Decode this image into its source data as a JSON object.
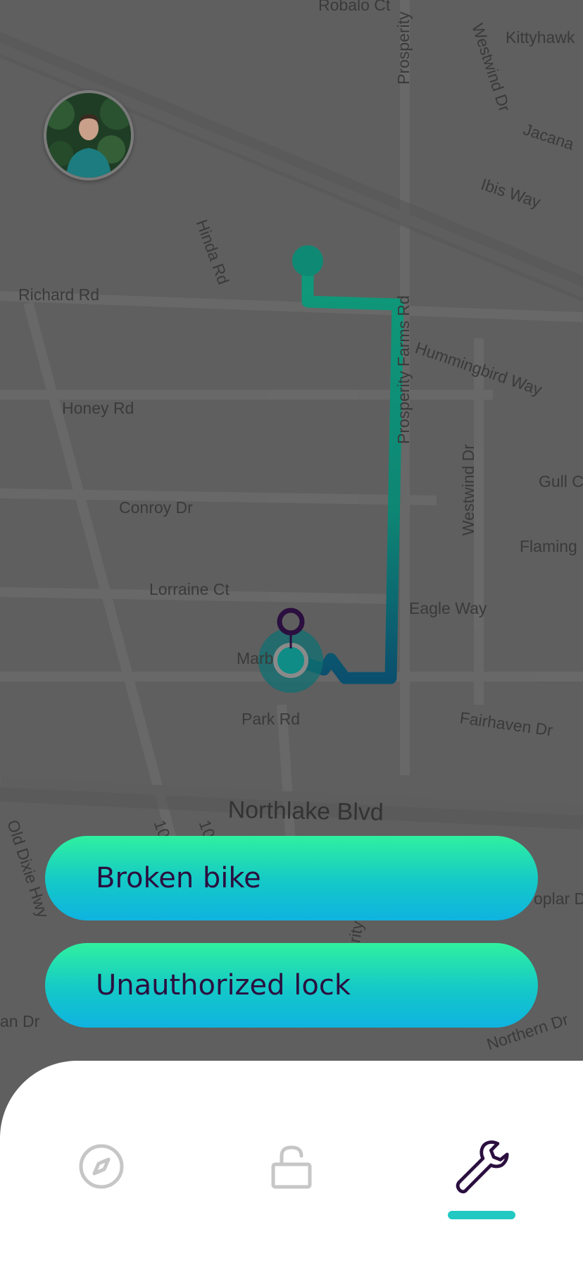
{
  "map": {
    "streets": [
      {
        "id": "robalo",
        "label": "Robalo Ct"
      },
      {
        "id": "kittyhawk",
        "label": "Kittyhawk"
      },
      {
        "id": "prosperity-top",
        "label": "Prosperity"
      },
      {
        "id": "westwind-top",
        "label": "Westwind Dr"
      },
      {
        "id": "jacana",
        "label": "Jacana"
      },
      {
        "id": "ibis",
        "label": "Ibis Way"
      },
      {
        "id": "hinda",
        "label": "Hinda Rd"
      },
      {
        "id": "richard",
        "label": "Richard Rd"
      },
      {
        "id": "prosperity-farms",
        "label": "Prosperity Farms Rd"
      },
      {
        "id": "hummingbird",
        "label": "Hummingbird Way"
      },
      {
        "id": "honey",
        "label": "Honey Rd"
      },
      {
        "id": "westwind-mid",
        "label": "Westwind Dr"
      },
      {
        "id": "gull",
        "label": "Gull C"
      },
      {
        "id": "conroy",
        "label": "Conroy Dr"
      },
      {
        "id": "flamingo",
        "label": "Flaming"
      },
      {
        "id": "lorraine",
        "label": "Lorraine Ct"
      },
      {
        "id": "eagle",
        "label": "Eagle Way"
      },
      {
        "id": "marb",
        "label": "Marb"
      },
      {
        "id": "fairhaven",
        "label": "Fairhaven Dr"
      },
      {
        "id": "park",
        "label": "Park Rd"
      },
      {
        "id": "northlake",
        "label": "Northlake Blvd"
      },
      {
        "id": "old-dixie",
        "label": "Old Dixie Hwy"
      },
      {
        "id": "poplar",
        "label": "oplar D"
      },
      {
        "id": "an-dr",
        "label": "an Dr"
      },
      {
        "id": "northern",
        "label": "Northern Dr"
      },
      {
        "id": "rity",
        "label": "rity"
      },
      {
        "id": "ten-a",
        "label": "10"
      },
      {
        "id": "ten-b",
        "label": "10"
      }
    ]
  },
  "actions": {
    "broken_bike": "Broken bike",
    "unauthorized_lock": "Unauthorized lock"
  },
  "nav": {
    "items": [
      {
        "icon": "compass-icon",
        "active": false
      },
      {
        "icon": "unlock-icon",
        "active": false
      },
      {
        "icon": "wrench-icon",
        "active": true
      }
    ]
  },
  "colors": {
    "route_start": "#0f9a7a",
    "route_end": "#0b4f6e",
    "marker": "#2b0f3f",
    "accent": "#22c9c2",
    "button_top": "#2ff0a0",
    "button_bottom": "#0fb3e0"
  }
}
